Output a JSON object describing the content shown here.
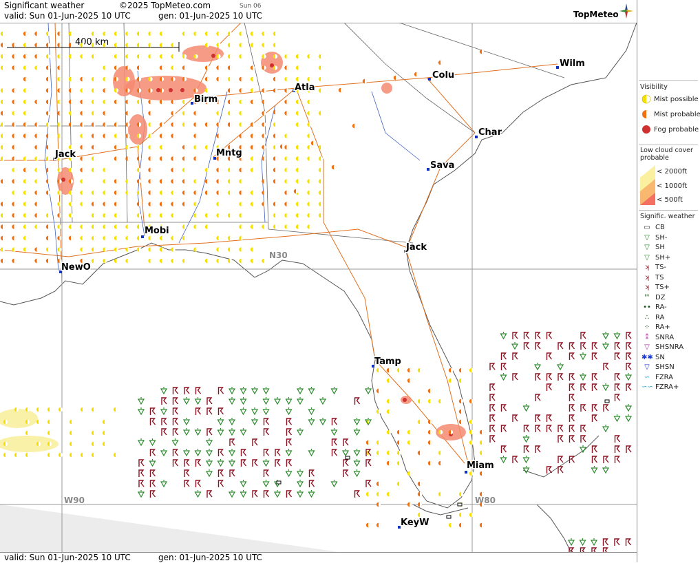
{
  "header": {
    "title": "Significant weather",
    "copyright": "©2025 TopMeteo.com",
    "day": "Sun 06",
    "valid": "valid:  Sun  01-Jun-2025  10 UTC",
    "generated": "gen: 01-Jun-2025 10 UTC",
    "brand": "TopMeteo"
  },
  "footer": {
    "valid": "valid:  Sun  01-Jun-2025  10 UTC",
    "generated": "gen: 01-Jun-2025 10 UTC"
  },
  "map": {
    "scale_label": "400 km",
    "grid_labels": {
      "n30": "N30",
      "w90": "W90",
      "w80": "W80"
    },
    "cities": {
      "birm": "Birm",
      "atla": "Atla",
      "colu": "Colu",
      "wilm": "Wilm",
      "char": "Char",
      "jack_ms": "Jack",
      "mntg": "Mntg",
      "sava": "Sava",
      "mobi": "Mobi",
      "jack_fl": "Jack",
      "newo": "NewO",
      "tamp": "Tamp",
      "miam": "Miam",
      "keyw": "KeyW"
    }
  },
  "legend": {
    "visibility": {
      "title": "Visibility",
      "items": [
        "Mist possible",
        "Mist probable",
        "Fog probable"
      ]
    },
    "low_cloud": {
      "title": "Low cloud cover probable",
      "items": [
        "< 2000ft",
        "< 1000ft",
        "<   500ft"
      ]
    },
    "sig_weather": {
      "title": "Signific. weather",
      "items": [
        "CB",
        "SH-",
        "SH",
        "SH+",
        "TS-",
        "TS",
        "TS+",
        "DZ",
        "RA-",
        "RA",
        "RA+",
        "SNRA",
        "SHSNRA",
        "SN",
        "SHSN",
        "FZRA",
        "FZRA+"
      ]
    }
  },
  "colors": {
    "mist_possible": "#f5e000",
    "mist_probable": "#f07010",
    "fog": "#d03030",
    "shower": "#2a8a2a",
    "thunder": "#8b1020",
    "road": "#e07020",
    "river": "#4060c0"
  }
}
